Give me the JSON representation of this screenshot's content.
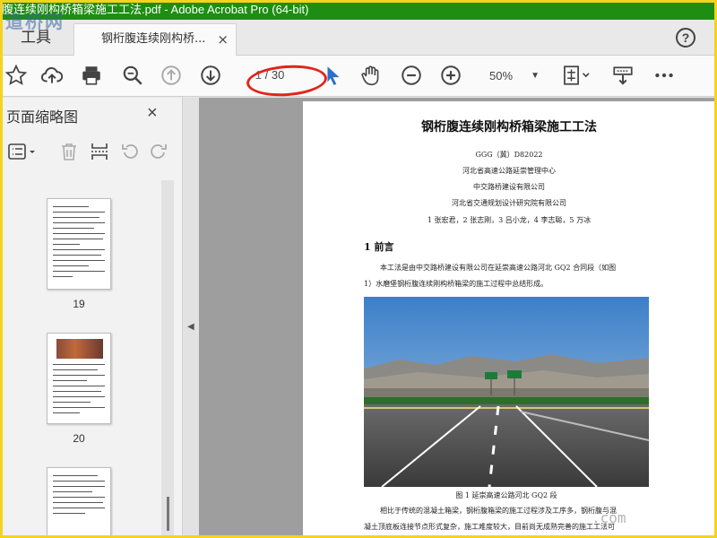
{
  "window": {
    "title": "腹连续刚构桥箱梁施工工法.pdf - Adobe Acrobat Pro (64-bit)"
  },
  "watermark": {
    "top_left": "道桥网",
    "bottom_right": ".com"
  },
  "tabs": {
    "tools_label": "工具",
    "doc_label": "钢桁腹连续刚构桥...",
    "close_glyph": "×",
    "help_glyph": "?"
  },
  "toolbar": {
    "page_current": "1",
    "page_total": "/ 30",
    "zoom": "50%"
  },
  "sidebar": {
    "title": "页面缩略图",
    "close_glyph": "×",
    "thumbnails": [
      {
        "label": "19"
      },
      {
        "label": "20"
      },
      {
        "label": ""
      }
    ]
  },
  "document": {
    "title": "钢桁腹连续刚构桥箱梁施工工法",
    "code": "GGG（冀）D82022",
    "org1": "河北省高速公路延崇管理中心",
    "org2": "中交路桥建设有限公司",
    "org3": "河北省交通规划设计研究院有限公司",
    "authors": "1 张宏君，2 张志刚，3 吕小龙，4 李志聪，5 万冰",
    "section1": "1 前言",
    "para1_line1": "本工法是由中交路桥建设有限公司在延崇高速公路河北 GQ2 合同段（如图",
    "para1_line2": "1）水磨堡钢桁腹连续刚构桥箱梁的施工过程中总结形成。",
    "figure_caption": "图 1 延崇高速公路河北 GQ2 段",
    "para2_line1": "相比于传统的混凝土箱梁，钢桁腹箱梁的施工过程涉及工序多，钢桁腹与混",
    "para2_line2": "凝土顶底板连接节点形式复杂，施工难度较大，目前尚无成熟完善的施工工法可"
  },
  "colors": {
    "titlebar": "#1e8e12",
    "accent_blue": "#2a6fc9",
    "annotation_red": "#e0261c",
    "frame": "#f4d31e"
  }
}
